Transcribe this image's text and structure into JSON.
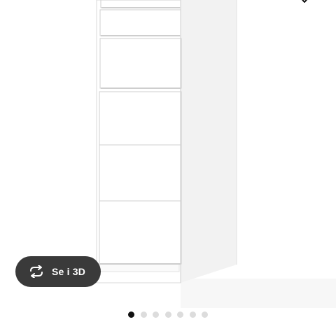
{
  "product": {
    "image_icon": "dresser-product-photo"
  },
  "favorite": {
    "icon": "heart-icon"
  },
  "view_3d": {
    "label": "Se i 3D",
    "icon": "rotate-3d-icon",
    "background": "#3a3a3a"
  },
  "carousel": {
    "total_slides": 7,
    "active_index": 0,
    "active_color": "#111111",
    "inactive_color": "#dcdcdc"
  }
}
